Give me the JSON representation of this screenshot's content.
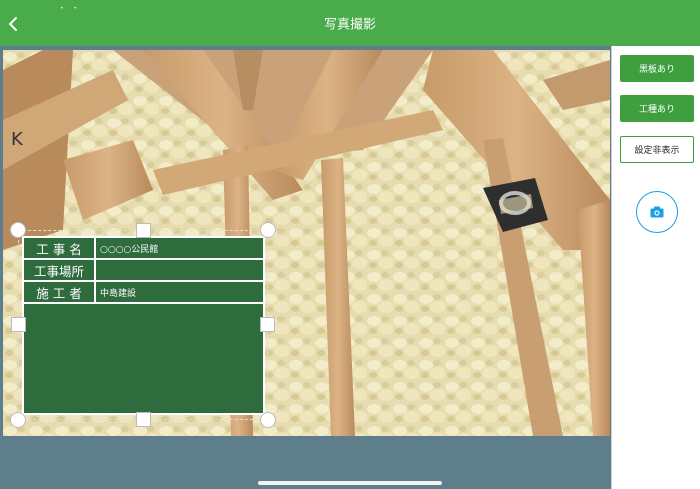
{
  "header": {
    "title": "写真撮影",
    "status_dots": "• •"
  },
  "sidebar": {
    "buttons": [
      {
        "label": "黒板あり"
      },
      {
        "label": "工種あり"
      },
      {
        "label": "設定非表示"
      }
    ]
  },
  "blackboard": {
    "rows": [
      {
        "label": "工 事 名",
        "value": "○○○○公民館"
      },
      {
        "label": "工事場所",
        "value": ""
      },
      {
        "label": "施 工 者",
        "value": "中島建設"
      }
    ]
  },
  "colors": {
    "header": "#4aab4a",
    "board": "#2e6b3d",
    "shutter_accent": "#1aa0e6",
    "camera_bg": "#5e7e8c"
  },
  "icons": {
    "back": "chevron-left-icon",
    "shutter": "camera-icon"
  }
}
